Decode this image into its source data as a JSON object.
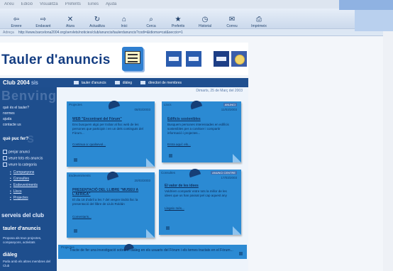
{
  "menu": [
    "Arxiu",
    "Edició",
    "Visualitza",
    "Preferits",
    "Eines",
    "Ajuda"
  ],
  "toolbar": [
    {
      "label": "Enrere",
      "icon": "back-icon"
    },
    {
      "label": "Endavant",
      "icon": "forward-icon"
    },
    {
      "label": "Atura",
      "icon": "stop-icon"
    },
    {
      "label": "Actualitza",
      "icon": "refresh-icon"
    },
    {
      "label": "Inici",
      "icon": "home-icon"
    },
    {
      "label": "Cerca",
      "icon": "search-icon"
    },
    {
      "label": "Preferits",
      "icon": "favorites-icon"
    },
    {
      "label": "Historial",
      "icon": "history-icon"
    },
    {
      "label": "Correu",
      "icon": "mail-icon"
    },
    {
      "label": "Imprimeix",
      "icon": "print-icon"
    }
  ],
  "address": {
    "label": "Adreça",
    "url": "http://www.barcelona2004.org/servlets/noticies/club/anuncis/taulerdanuncis?codi=&idioma=cat&seccio=1"
  },
  "site": {
    "title": "Tauler d'anuncis"
  },
  "navbar": {
    "club_prefix": "Club 2004",
    "club_suffix": "sis",
    "items": [
      "tauler d'anuncis",
      "diàleg",
      "directori de membres"
    ]
  },
  "sidebar": {
    "watermark1": "Benvingut",
    "watermark2": "s",
    "links": [
      "què és el tauler?",
      "normes",
      "ajuda",
      "contacte us"
    ],
    "section": "què puc fer?",
    "actions": [
      "penjar anunci",
      "veure tots els anuncis",
      "veure la categoria"
    ],
    "categories": [
      "Companyons",
      "Consultes",
      "Esdeveniments",
      "Llocs",
      "Projectes"
    ],
    "services_heading": "serveis del club",
    "service1": {
      "title": "tauler d'anuncis",
      "desc": "Proposa als teus projectes, companyons, activitats"
    },
    "service2": {
      "title": "diàleg",
      "desc": "Parla amb els altres membres del Club"
    }
  },
  "content": {
    "date": "Dimarts, 25 de Març del 2003",
    "notes": [
      {
        "category": "Projectes",
        "date": "08/03/2003",
        "badge": "",
        "title": "WEB \"Encontrant del Fòrum\"",
        "text": "Ens busquem algú per trobar al lloc web de les persones que participin i en un dels continguts del Fòrum...",
        "more": "Continua a: qualsevol..."
      },
      {
        "category": "Llocs",
        "date": "11/03/2003",
        "badge": "ANUNCI",
        "title": "Edificis sostenibles",
        "text": "Busquem persones interessades en edificis sostenibles per a conèixer i compartir informació i projectes...",
        "more": "Entra aquí: els..."
      },
      {
        "category": "Esdeveniments",
        "date": "20/03/2003",
        "badge": "",
        "title": "PRESENTACIÓ DEL LLIBRE \"MUSEU A L'ÀFRICA\"",
        "text": "El dia 18 d'abril a les 7 del vespre tindrà lloc la presentació del llibre de Lluís Roldán",
        "more": "Comentaris..."
      },
      {
        "category": "Consultes",
        "date": "17/03/2003",
        "badge": "ANUNCI CENTRE",
        "title": "El valor de les idees",
        "text": "Voldríem compartir entre tots la millor de les idees que us han passat pel cap aquest any",
        "more": "Llegeix més..."
      }
    ],
    "bottom": {
      "category": "Projectes",
      "text": "Tracte de fer una investigació sobre el diàleg en els usuaris del Fòrum i els temes tractats en el Fòrum..."
    }
  }
}
